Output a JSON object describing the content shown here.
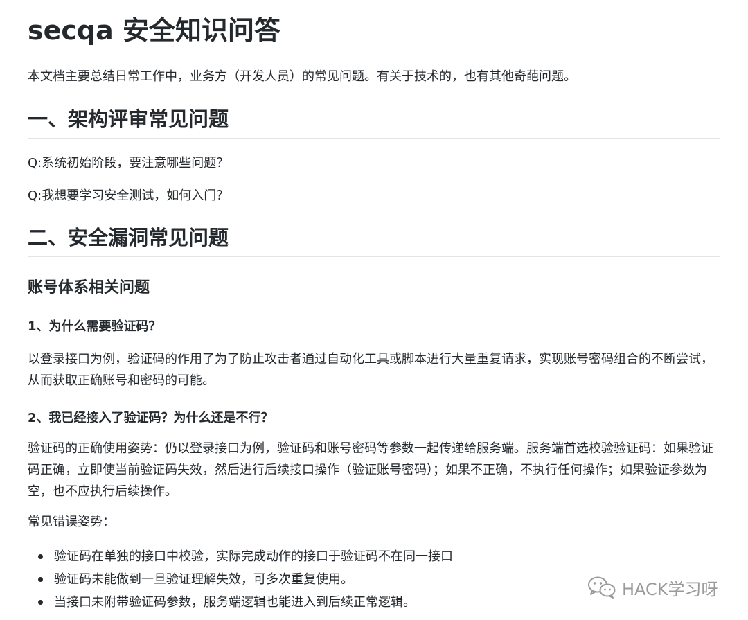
{
  "doc": {
    "title": "secqa 安全知识问答",
    "intro": "本文档主要总结日常工作中，业务方（开发人员）的常见问题。有关于技术的，也有其他奇葩问题。",
    "section1": {
      "heading": "一、架构评审常见问题",
      "questions": [
        "Q:系统初始阶段，要注意哪些问题？",
        "Q:我想要学习安全测试，如何入门？"
      ]
    },
    "section2": {
      "heading": "二、安全漏洞常见问题",
      "subheading": "账号体系相关问题",
      "q1": {
        "title": "1、为什么需要验证码？",
        "answer": " 以登录接口为例，验证码的作用了为了防止攻击者通过自动化工具或脚本进行大量重复请求，实现账号密码组合的不断尝试，从而获取正确账号和密码的可能。"
      },
      "q2": {
        "title": "2、我已经接入了验证码？为什么还是不行？",
        "answer": " 验证码的正确使用姿势：仍以登录接口为例，验证码和账号密码等参数一起传递给服务端。服务端首选校验验证码：如果验证码正确，立即使当前验证码失效，然后进行后续接口操作（验证账号密码）；如果不正确，不执行任何操作；如果验证参数为空，也不应执行后续操作。",
        "mistakes_label": "常见错误姿势：",
        "mistakes": [
          "验证码在单独的接口中校验，实际完成动作的接口于验证码不在同一接口",
          "验证码未能做到一旦验证理解失效，可多次重复使用。",
          "当接口未附带验证码参数，服务端逻辑也能进入到后续正常逻辑。"
        ]
      }
    }
  },
  "watermark": {
    "text": "HACK学习呀",
    "icon": "wechat-icon"
  }
}
